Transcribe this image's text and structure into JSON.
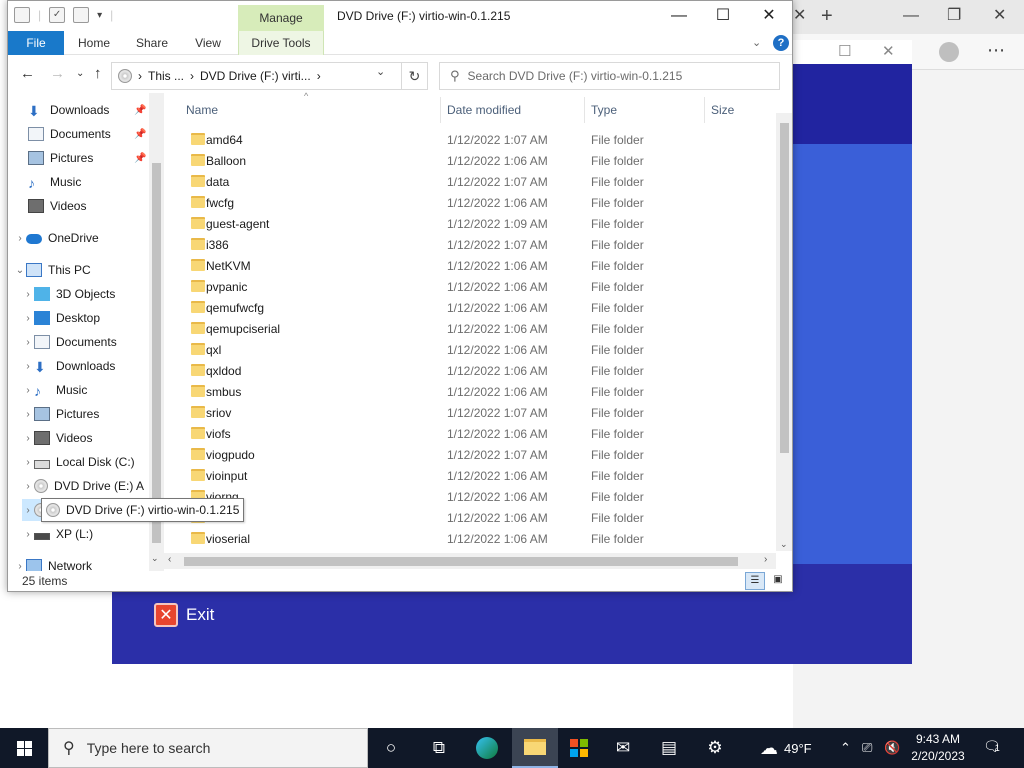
{
  "explorer": {
    "title": "DVD Drive (F:) virtio-win-0.1.215",
    "manage_label": "Manage",
    "tabs": [
      "File",
      "Home",
      "Share",
      "View",
      "Drive Tools"
    ],
    "address": {
      "segment1": "This ...",
      "segment2": "DVD Drive (F:) virti...",
      "sep": "›"
    },
    "search_placeholder": "Search DVD Drive (F:) virtio-win-0.1.215",
    "columns": {
      "name": "Name",
      "date": "Date modified",
      "type": "Type",
      "size": "Size"
    },
    "nav": {
      "downloads_quick": "Downloads",
      "documents_quick": "Documents",
      "pictures_quick": "Pictures",
      "music_quick": "Music",
      "videos_quick": "Videos",
      "onedrive": "OneDrive",
      "thispc": "This PC",
      "objects3d": "3D Objects",
      "desktop": "Desktop",
      "documents": "Documents",
      "downloads": "Downloads",
      "music": "Music",
      "pictures": "Pictures",
      "videos": "Videos",
      "localdisk": "Local Disk (C:)",
      "dvde": "DVD Drive (E:) A",
      "dvdf": "DVD Drive (F:) virtio-win-0.1.215",
      "xp": "XP (L:)",
      "network": "Network"
    },
    "tooltip": "DVD Drive (F:) virtio-win-0.1.215",
    "files": [
      {
        "name": "amd64",
        "date": "1/12/2022 1:07 AM",
        "type": "File folder"
      },
      {
        "name": "Balloon",
        "date": "1/12/2022 1:06 AM",
        "type": "File folder"
      },
      {
        "name": "data",
        "date": "1/12/2022 1:07 AM",
        "type": "File folder"
      },
      {
        "name": "fwcfg",
        "date": "1/12/2022 1:06 AM",
        "type": "File folder"
      },
      {
        "name": "guest-agent",
        "date": "1/12/2022 1:09 AM",
        "type": "File folder"
      },
      {
        "name": "i386",
        "date": "1/12/2022 1:07 AM",
        "type": "File folder"
      },
      {
        "name": "NetKVM",
        "date": "1/12/2022 1:06 AM",
        "type": "File folder"
      },
      {
        "name": "pvpanic",
        "date": "1/12/2022 1:06 AM",
        "type": "File folder"
      },
      {
        "name": "qemufwcfg",
        "date": "1/12/2022 1:06 AM",
        "type": "File folder"
      },
      {
        "name": "qemupciserial",
        "date": "1/12/2022 1:06 AM",
        "type": "File folder"
      },
      {
        "name": "qxl",
        "date": "1/12/2022 1:06 AM",
        "type": "File folder"
      },
      {
        "name": "qxldod",
        "date": "1/12/2022 1:06 AM",
        "type": "File folder"
      },
      {
        "name": "smbus",
        "date": "1/12/2022 1:06 AM",
        "type": "File folder"
      },
      {
        "name": "sriov",
        "date": "1/12/2022 1:07 AM",
        "type": "File folder"
      },
      {
        "name": "viofs",
        "date": "1/12/2022 1:06 AM",
        "type": "File folder"
      },
      {
        "name": "viogpudo",
        "date": "1/12/2022 1:07 AM",
        "type": "File folder"
      },
      {
        "name": "vioinput",
        "date": "1/12/2022 1:06 AM",
        "type": "File folder"
      },
      {
        "name": "viorng",
        "date": "1/12/2022 1:06 AM",
        "type": "File folder"
      },
      {
        "name": "vioscsi",
        "date": "1/12/2022 1:06 AM",
        "type": "File folder"
      },
      {
        "name": "vioserial",
        "date": "1/12/2022 1:06 AM",
        "type": "File folder"
      }
    ],
    "status": "25 items"
  },
  "installer": {
    "exit_label": "Exit"
  },
  "taskbar": {
    "search_placeholder": "Type here to search",
    "weather": "49°F",
    "time": "9:43 AM",
    "date": "2/20/2023",
    "notif_count": "1"
  },
  "colors": {
    "file_tab": "#1979ca",
    "manage_tab": "#d7ecba",
    "installer_blue": "#2b2fa8",
    "taskbar": "#101828"
  }
}
